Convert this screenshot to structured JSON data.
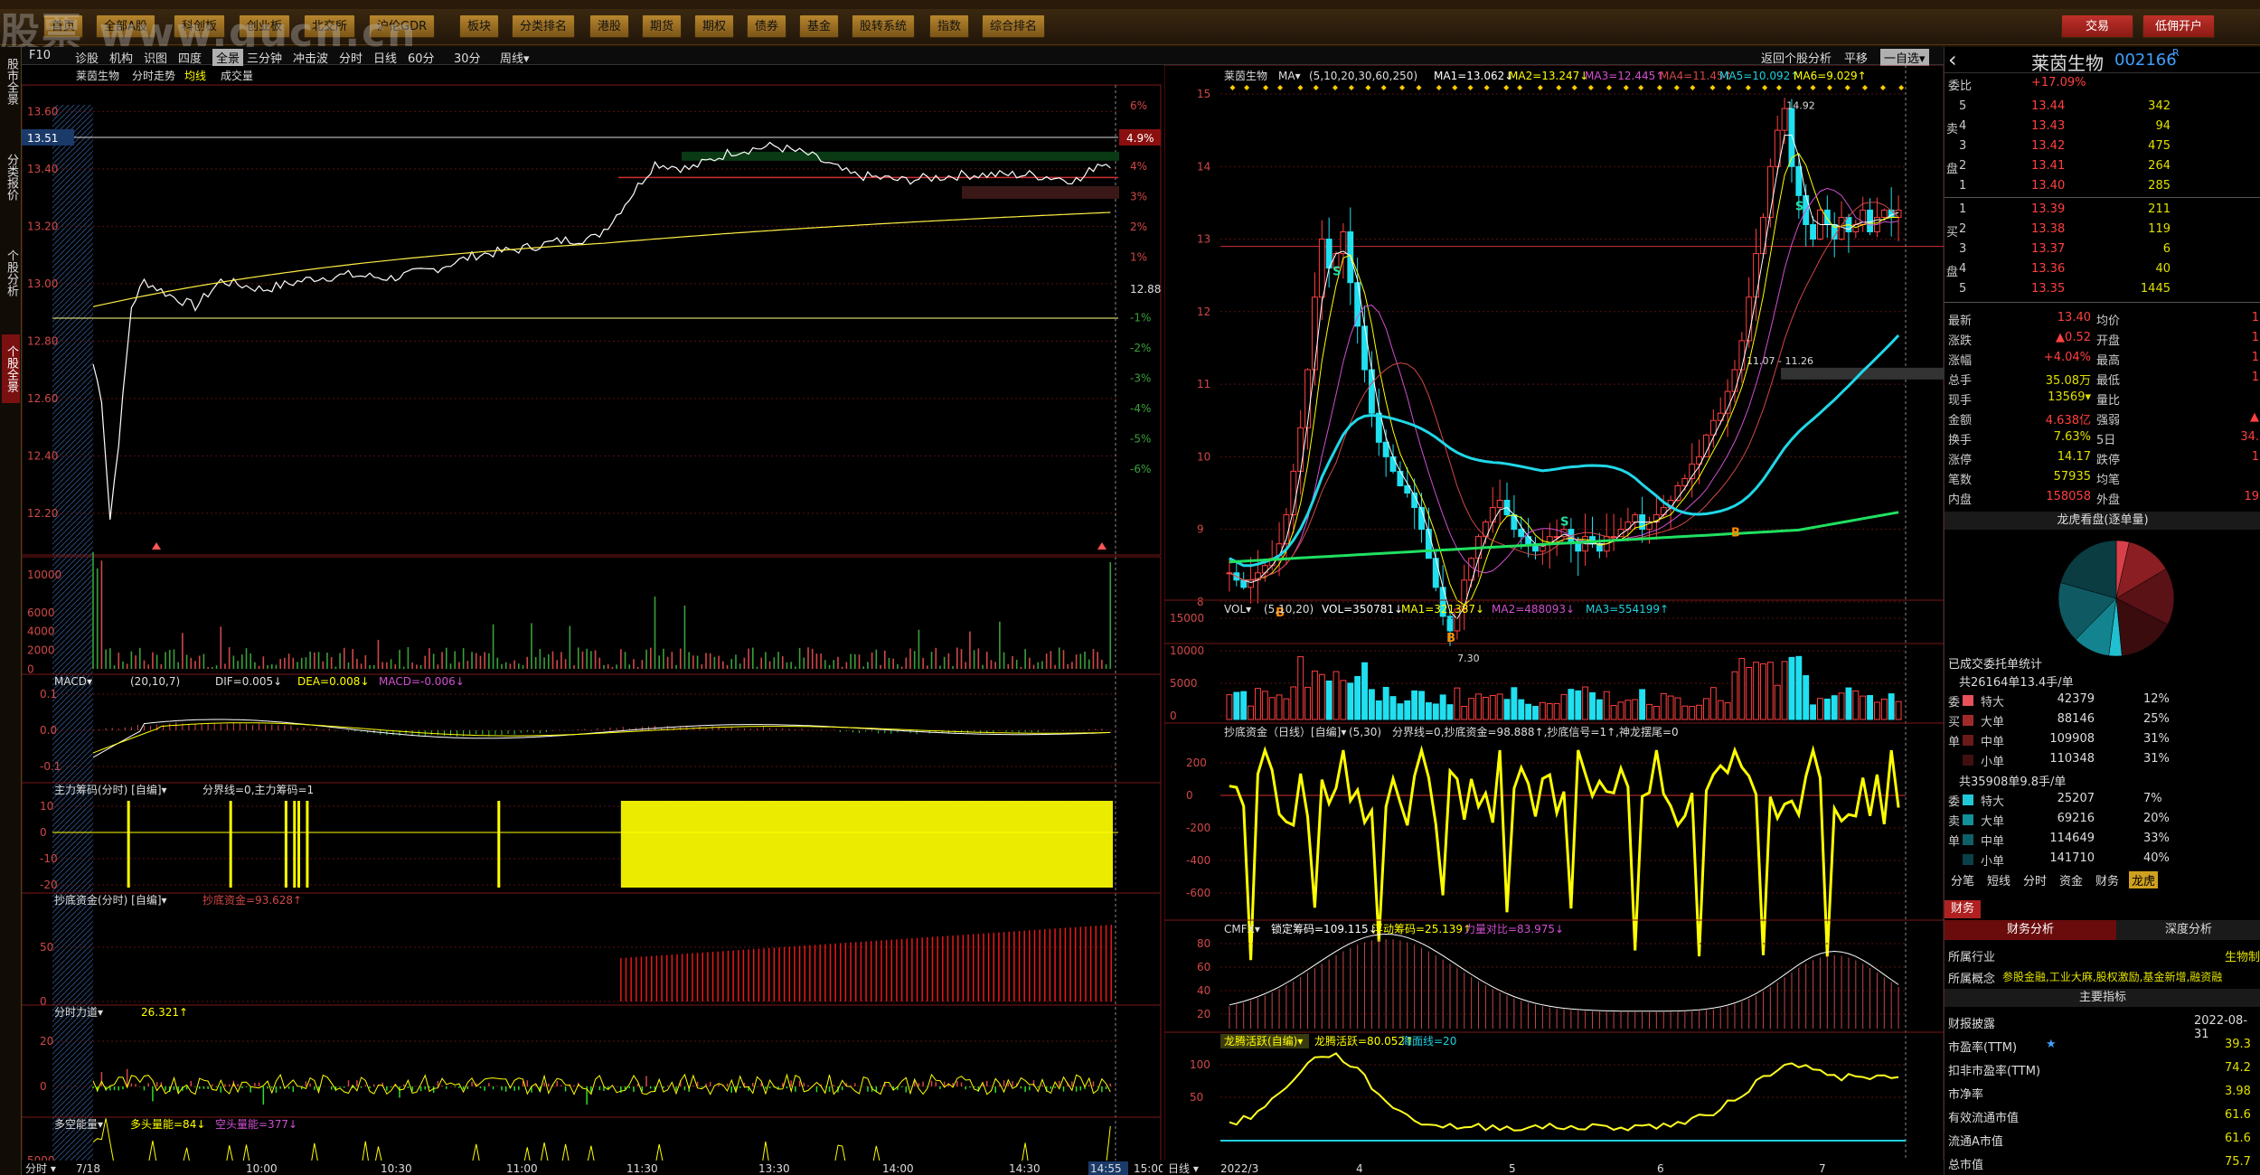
{
  "watermark": "股票 www.gucn.cn",
  "menu": {
    "buttons": [
      "首页",
      "全部A股",
      "科创板",
      "创业板",
      "北交所",
      "沪伦GDR",
      "板块",
      "分类排名",
      "港股",
      "期货",
      "期权",
      "债券",
      "基金",
      "股转系统",
      "指数",
      "综合排名"
    ],
    "trade": "交易",
    "low_commission": "低佣开户"
  },
  "left_tabs": [
    "股市全景",
    "分类报价",
    "个股分析",
    "个股全景"
  ],
  "toolbar": {
    "left": [
      "F10",
      "诊股",
      "机构",
      "识图",
      "四度",
      "全景",
      "三分钟",
      "冲击波",
      "分时",
      "日线",
      "60分",
      "30分",
      "周线▾"
    ],
    "right": [
      "返回个股分析",
      "平移",
      "一自选▾"
    ]
  },
  "intraday": {
    "stock": "莱茵生物",
    "label": "分时走势",
    "avg": "均线",
    "vol": "成交量",
    "price_ticks": [
      "13.60",
      "13.40",
      "13.20",
      "13.00",
      "12.80",
      "12.60",
      "12.40",
      "12.20"
    ],
    "pct_ticks": [
      "6%",
      "5%",
      "4%",
      "3%",
      "2%",
      "1%",
      "",
      "-1%",
      "-2%",
      "-3%",
      "-4%",
      "-5%",
      "-6%"
    ],
    "mid_price": "12.88",
    "current_pct": "4.9%",
    "cursor_price": "13.51",
    "vol_ticks": [
      "10000",
      "6000",
      "4000",
      "2000",
      "0"
    ],
    "time_ticks": [
      "7/18",
      "10:00",
      "10:30",
      "11:00",
      "11:30",
      "13:30",
      "14:00",
      "14:30",
      "14:55",
      "15:00"
    ],
    "footer_label": "分时",
    "macd_title": "MACD▾",
    "macd_params": "(20,10,7)",
    "macd_dif": "DIF=0.005↓",
    "macd_dea": "DEA=0.008↓",
    "macd_val": "MACD=-0.006↓",
    "macd_ticks": [
      "0.1",
      "0.0",
      "-0.1"
    ],
    "zljm_title": "主力筹码(分时) [自编]▾",
    "zljm_vals": "分界线=0,主力筹码=1",
    "zljm_ticks": [
      "10",
      "0",
      "-10",
      "-20"
    ],
    "cdzj_title": "抄底资金(分时) [自编]▾",
    "cdzj_val": "抄底资金=93.628↑",
    "cdzj_ticks": [
      "50",
      "0"
    ],
    "fsld_title": "分时力道▾",
    "fsld_val": "26.321↑",
    "fsld_ticks": [
      "20",
      "0"
    ],
    "dkn_title": "多空能量▾",
    "dkn_v1": "多头量能=84↓",
    "dkn_v2": "空头量能=377↓",
    "dkn_ticks": [
      "5000",
      "0"
    ]
  },
  "daily": {
    "stock": "莱茵生物",
    "ma_title": "MA▾",
    "ma_params": "(5,10,20,30,60,250)",
    "ma1": "MA1=13.062↓",
    "ma2": "MA2=13.247↓",
    "ma3": "MA3=12.445↑",
    "ma4": "MA4=11.45↑",
    "ma5": "MA5=10.092↑",
    "ma6": "MA6=9.029↑",
    "price_ticks": [
      "15",
      "14",
      "13",
      "12",
      "11",
      "10",
      "9",
      "8"
    ],
    "high_label": "14.92",
    "low_label": "7.30",
    "range_label": "11.07 - 11.26",
    "vol_title": "VOL▾",
    "vol_params": "(5,10,20)",
    "vol_v": "VOL=350781↓",
    "vol_ma1": "MA1=321387↓",
    "vol_ma2": "MA2=488093↓",
    "vol_ma3": "MA3=554199↑",
    "vol_ticks": [
      "15000",
      "10000",
      "5000",
      "0"
    ],
    "cdzj_title": "抄底资金（日线）[自编]▾",
    "cdzj_params": "(5,30)",
    "cdzj_vals": "分界线=0,抄底资金=98.888↑,抄底信号=1↑,神龙摆尾=0",
    "cdzj_ticks": [
      "200",
      "0",
      "-200",
      "-400",
      "-600"
    ],
    "cmfx_title": "CMFX▾",
    "cmfx_v1": "锁定筹码=109.115↓",
    "cmfx_v2": "浮动筹码=25.139↑",
    "cmfx_v3": "力量对比=83.975↓",
    "cmfx_ticks": [
      "80",
      "60",
      "40",
      "20"
    ],
    "lthy_title": "龙腾活跃(自编)▾",
    "lthy_v1": "龙腾活跃=80.052↑",
    "lthy_v2": "海面线=20",
    "lthy_ticks": [
      "100",
      "50"
    ],
    "date_ticks": [
      "2022/3",
      "4",
      "5",
      "6",
      "7"
    ],
    "footer_label": "日线"
  },
  "panel": {
    "name": "莱茵生物",
    "code": "002166",
    "code_mark": "R",
    "weibi_label": "委比",
    "weibi_val": "+17.09%",
    "sell": [
      {
        "l": "5",
        "p": "13.44",
        "v": "342"
      },
      {
        "l": "4",
        "p": "13.43",
        "v": "94"
      },
      {
        "l": "3",
        "p": "13.42",
        "v": "475"
      },
      {
        "l": "2",
        "p": "13.41",
        "v": "264"
      },
      {
        "l": "1",
        "p": "13.40",
        "v": "285"
      }
    ],
    "sell_label": "卖",
    "pan_label": "盘",
    "buy": [
      {
        "l": "1",
        "p": "13.39",
        "v": "211"
      },
      {
        "l": "2",
        "p": "13.38",
        "v": "119"
      },
      {
        "l": "3",
        "p": "13.37",
        "v": "6"
      },
      {
        "l": "4",
        "p": "13.36",
        "v": "40"
      },
      {
        "l": "5",
        "p": "13.35",
        "v": "1445"
      }
    ],
    "buy_label": "买",
    "stats": [
      {
        "a": "最新",
        "b": "13.40",
        "c": "均价",
        "d": "1"
      },
      {
        "a": "涨跌",
        "b": "▲0.52",
        "c": "开盘",
        "d": "1"
      },
      {
        "a": "涨幅",
        "b": "+4.04%",
        "c": "最高",
        "d": "1"
      },
      {
        "a": "总手",
        "b": "35.08万",
        "c": "最低",
        "d": "1"
      },
      {
        "a": "现手",
        "b": "13569▾",
        "c": "量比",
        "d": ""
      },
      {
        "a": "金额",
        "b": "4.638亿",
        "c": "强弱",
        "d": "▲"
      },
      {
        "a": "换手",
        "b": "7.63%",
        "c": "5日",
        "d": "34."
      },
      {
        "a": "涨停",
        "b": "14.17",
        "c": "跌停",
        "d": "1"
      },
      {
        "a": "笔数",
        "b": "57935",
        "c": "均笔",
        "d": ""
      },
      {
        "a": "内盘",
        "b": "158058",
        "c": "外盘",
        "d": "19"
      }
    ],
    "dragon_title": "龙虎看盘(逐单量)",
    "pie": [
      {
        "v": 7,
        "c": "#d8404a"
      },
      {
        "v": 25,
        "c": "#8a1e22"
      },
      {
        "v": 31,
        "c": "#5a1216"
      },
      {
        "v": 31,
        "c": "#3a0c0e"
      },
      {
        "v": 7,
        "c": "#20c0d0"
      },
      {
        "v": 20,
        "c": "#13848f"
      },
      {
        "v": 33,
        "c": "#0f5a62"
      },
      {
        "v": 40,
        "c": "#0a3c42"
      }
    ],
    "deal_title": "已成交委托单统计",
    "buy_total": "共26164单13.4手/单",
    "buy_rows": [
      {
        "t": "委",
        "n": "特大",
        "v": "42379",
        "p": "12%",
        "c": "#e8505a"
      },
      {
        "t": "买",
        "n": "大单",
        "v": "88146",
        "p": "25%",
        "c": "#a02a2a"
      },
      {
        "t": "单",
        "n": "中单",
        "v": "109908",
        "p": "31%",
        "c": "#6a1a1a"
      },
      {
        "t": "",
        "n": "小单",
        "v": "110348",
        "p": "31%",
        "c": "#401010"
      }
    ],
    "sell_total": "共35908单9.8手/单",
    "sell_rows": [
      {
        "t": "委",
        "n": "特大",
        "v": "25207",
        "p": "7%",
        "c": "#20c8d8"
      },
      {
        "t": "卖",
        "n": "大单",
        "v": "69216",
        "p": "20%",
        "c": "#149098"
      },
      {
        "t": "单",
        "n": "中单",
        "v": "114649",
        "p": "33%",
        "c": "#0e6068"
      },
      {
        "t": "",
        "n": "小单",
        "v": "141710",
        "p": "40%",
        "c": "#0a4048"
      }
    ],
    "tabs": [
      "分笔",
      "短线",
      "分时",
      "资金",
      "财务",
      "龙虎"
    ],
    "caiwu": "财务",
    "fa_tab1": "财务分析",
    "fa_tab2": "深度分析",
    "industry_label": "所属行业",
    "industry_val": "生物制",
    "concept_label": "所属概念",
    "concept_val": "参股金融,工业大麻,股权激励,基金新增,融资融",
    "main_index": "主要指标",
    "report_label": "财报披露",
    "report_val": "2022-08-31",
    "indicators": [
      {
        "k": "市盈率(TTM)",
        "s": "★",
        "v": "39.3"
      },
      {
        "k": "扣非市盈率(TTM)",
        "s": "",
        "v": "74.2"
      },
      {
        "k": "市净率",
        "s": "",
        "v": "3.98"
      },
      {
        "k": "有效流通市值",
        "s": "",
        "v": "61.6"
      },
      {
        "k": "流通A市值",
        "s": "",
        "v": "61.6"
      },
      {
        "k": "总市值",
        "s": "",
        "v": "75.7"
      }
    ]
  }
}
